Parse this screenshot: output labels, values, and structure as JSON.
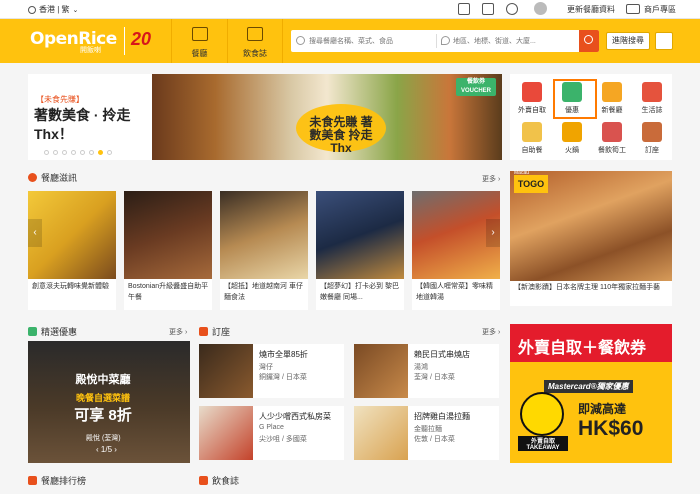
{
  "topbar": {
    "region": "香港 | 繁",
    "update_label": "更新餐廳資料",
    "merchant_label": "商戶專區"
  },
  "header": {
    "logo_text": "OpenRice",
    "logo_sub": "開飯喇",
    "logo_badge": "20",
    "nav": [
      {
        "label": "餐廳"
      },
      {
        "label": "飲食誌"
      }
    ],
    "search": {
      "keyword_placeholder": "搜尋餐廳名稱、菜式、食品",
      "location_placeholder": "地區、地標、街道、大廈..."
    },
    "advanced_label": "進階搜尋"
  },
  "banner": {
    "tag": "【未食先賺】",
    "title": "著數美食 · 拎走 Thx！",
    "image_caption": "未食先賺 著數美食 拎走Thx",
    "voucher": "餐飲券 VOUCHER",
    "dots": [
      0,
      0,
      0,
      0,
      0,
      0,
      1,
      0
    ]
  },
  "categories": [
    {
      "label": "外賣自取"
    },
    {
      "label": "優惠"
    },
    {
      "label": "新餐廳"
    },
    {
      "label": "生活誌"
    },
    {
      "label": "自助餐"
    },
    {
      "label": "火鍋"
    },
    {
      "label": "餐飲筍工"
    },
    {
      "label": "訂座"
    }
  ],
  "sections": {
    "feature": {
      "title": "餐廳滋訊",
      "more": "更多"
    },
    "deals": {
      "title": "精選優惠",
      "more": "更多"
    },
    "booking": {
      "title": "訂座",
      "more": "更多"
    },
    "ranking": {
      "title": "餐廳排行榜"
    },
    "magazine": {
      "title": "飲食誌"
    }
  },
  "feature_cards": [
    {
      "caption": "創意滾夫玩轉味覺新體驗"
    },
    {
      "caption": "Bostonian升級醬盛自助平午餐"
    },
    {
      "caption": "【超抵】地道越南河 車仔麵食法"
    },
    {
      "caption": "【超夢幻】打卡必到 黎巴嫩餐廳 同場..."
    },
    {
      "caption": "【韓國人喱常菜】零味精 地道韓湯"
    }
  ],
  "togo": {
    "badge": "TOGO",
    "region_tag": "Macau",
    "caption": "【新澳影蹟】日本名牌主理 110年獨家拉麵手藝"
  },
  "deal": {
    "name": "殿悅中菜廳",
    "line1": "晚餐自選菜譜",
    "line2": "可享 8折",
    "restaurant": "殿悅 (荃灣)",
    "pager": "1/5"
  },
  "bookings": [
    {
      "title": "燒市全單85折",
      "sub1": "灣仔",
      "sub2": "銅鑼灣 / 日本菜"
    },
    {
      "title": "賴民日式串燒店",
      "sub1": "湯鴻",
      "sub2": "荃灣 / 日本菜"
    },
    {
      "title": "人少少嚐西式私房菜",
      "sub1": "G Place",
      "sub2": "尖沙咀 / 多國菜"
    },
    {
      "title": "招牌雞白湯拉麵",
      "sub1": "金聽拉麵",
      "sub2": "佐敦 / 日本菜"
    }
  ],
  "promo": {
    "top": "外賣自取＋餐飲券",
    "card": "Mastercard®獨家優惠",
    "line1": "即減高達",
    "line2": "HK$60",
    "takeaway": "外賣自取 TAKEAWAY"
  }
}
